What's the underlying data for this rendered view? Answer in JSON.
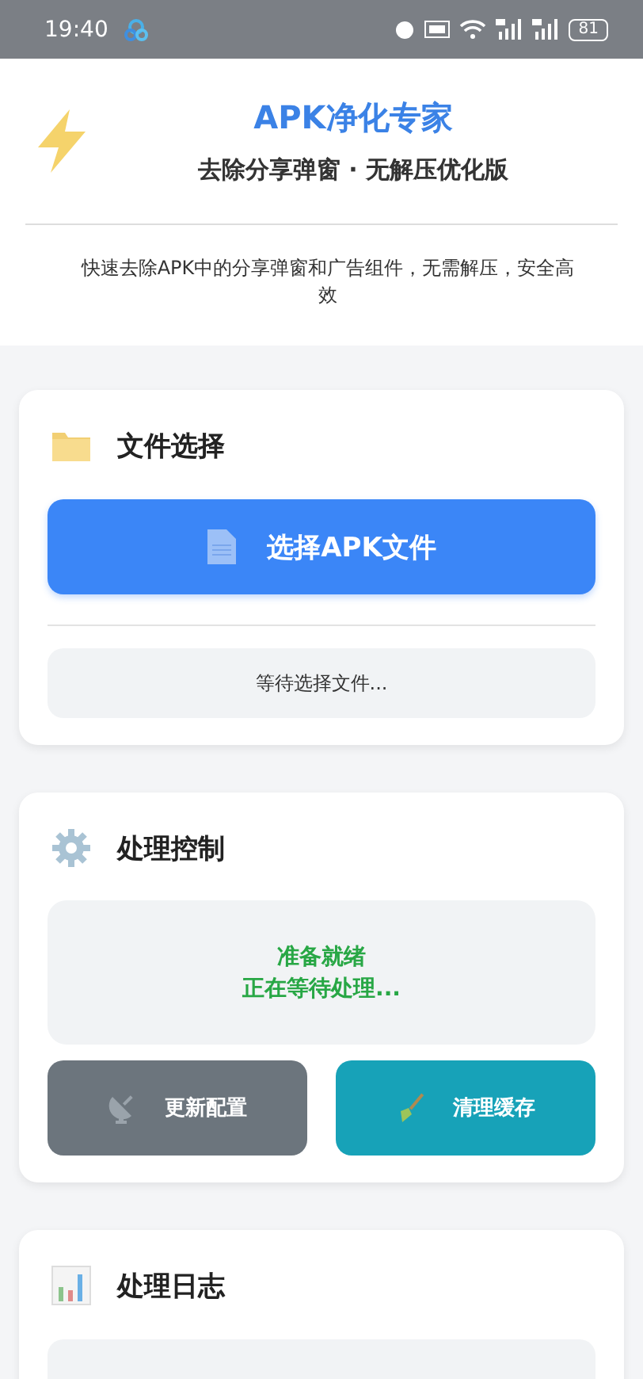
{
  "status_bar": {
    "time": "19:40",
    "battery": "81"
  },
  "header": {
    "title": "APK净化专家",
    "subtitle": "去除分享弹窗 · 无解压优化版",
    "description": "快速去除APK中的分享弹窗和广告组件，无需解压，安全高效"
  },
  "cards": [
    {
      "kind": "file",
      "title": "文件选择",
      "button": "选择APK文件",
      "status": "等待选择文件..."
    },
    {
      "kind": "control",
      "title": "处理控制",
      "status_lines": [
        "准备就绪",
        "正在等待处理..."
      ],
      "buttons": [
        {
          "label": "更新配置",
          "kind": "update"
        },
        {
          "label": "清理缓存",
          "kind": "clear"
        }
      ]
    },
    {
      "kind": "log",
      "title": "处理日志"
    }
  ]
}
